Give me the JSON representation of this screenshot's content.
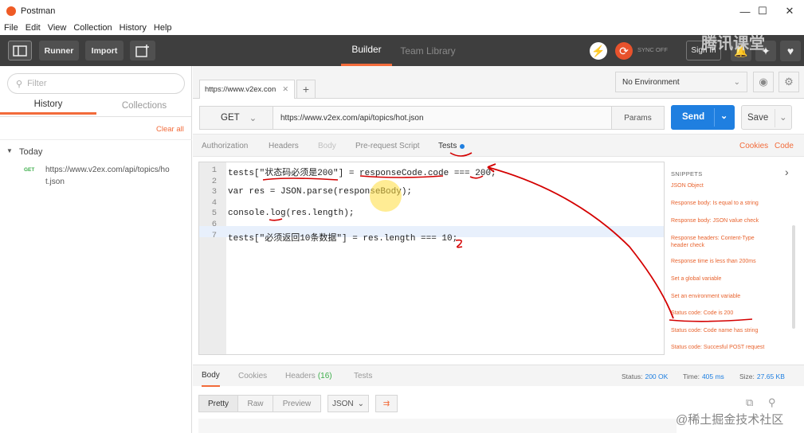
{
  "window": {
    "title": "Postman",
    "minimize": "—",
    "maximize": "☐",
    "close": "✕"
  },
  "menu": [
    "File",
    "Edit",
    "View",
    "Collection",
    "History",
    "Help"
  ],
  "toolbar": {
    "runner": "Runner",
    "import": "Import",
    "builder": "Builder",
    "team_library": "Team Library",
    "sync": "SYNC OFF",
    "signin": "Sign In"
  },
  "sidebar": {
    "filter_placeholder": "Filter",
    "tabs": [
      "History",
      "Collections"
    ],
    "clear_all": "Clear all",
    "group": "Today",
    "history_item": {
      "method": "GET",
      "url_line1": "https://www.v2ex.com/api/topics/ho",
      "url_line2": "t.json"
    }
  },
  "request": {
    "tab_label": "https://www.v2ex.con",
    "env": "No Environment",
    "method": "GET",
    "url": "https://www.v2ex.com/api/topics/hot.json",
    "params": "Params",
    "send": "Send",
    "save": "Save",
    "subtabs": [
      "Authorization",
      "Headers",
      "Body",
      "Pre-request Script",
      "Tests"
    ],
    "cookies": "Cookies",
    "code": "Code"
  },
  "editor": {
    "line_numbers": [
      "1",
      "2",
      "3",
      "4",
      "5",
      "6",
      "7"
    ],
    "line1": "tests[\"状态码必须是200\"] = responseCode.code === 200;",
    "line3": "var res = JSON.parse(responseBody);",
    "line5": "console.log(res.length);",
    "line7": "tests[\"必须返回10条数据\"] = res.length === 10;"
  },
  "snippets": {
    "title": "SNIPPETS",
    "items": [
      "JSON Object",
      "Response body: Is equal to a string",
      "Response body: JSON value check",
      "Response headers: Content-Type header check",
      "Response time is less than 200ms",
      "Set a global variable",
      "Set an environment variable",
      "Status code: Code is 200",
      "Status code: Code name has string",
      "Status code: Succesful POST request"
    ]
  },
  "response": {
    "tabs": [
      "Body",
      "Cookies",
      "Headers",
      "Tests"
    ],
    "headers_count": "(16)",
    "status_label": "Status:",
    "status_value": "200 OK",
    "time_label": "Time:",
    "time_value": "405 ms",
    "size_label": "Size:",
    "size_value": "27.65 KB",
    "views": [
      "Pretty",
      "Raw",
      "Preview"
    ],
    "format": "JSON"
  },
  "watermarks": {
    "top": "腾讯课堂",
    "bottom": "@稀土掘金技术社区"
  },
  "colors": {
    "accent": "#f26b3a",
    "send": "#1f7fe0",
    "toolbar": "#3e3e3e",
    "annotation": "#d40000"
  }
}
